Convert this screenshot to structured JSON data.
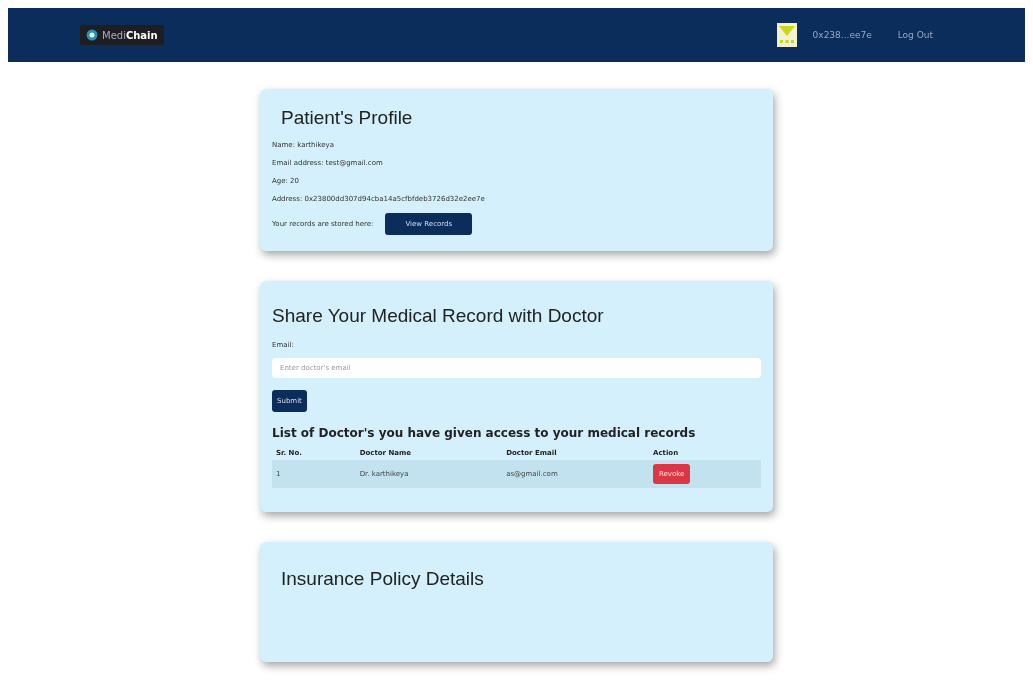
{
  "navbar": {
    "brand_light": "Medi",
    "brand_bold": "Chain",
    "account": "0x238...ee7e",
    "logout": "Log Out"
  },
  "profile": {
    "title": "Patient's Profile",
    "lines": [
      "Name: karthikeya",
      "Email address: test@gmail.com",
      "Age: 20",
      "Address: 0x23800dd307d94cba14a5cfbfdeb3726d32e2ee7e"
    ],
    "records_label": "Your records are stored here:",
    "records_button": "View Records"
  },
  "share": {
    "title": "Share Your Medical Record with Doctor",
    "email_label": "Email:",
    "placeholder": "Enter doctor's email",
    "submit": "Submit",
    "list_title": "List of Doctor's you have given access to your medical records",
    "columns": [
      "Sr. No.",
      "Doctor Name",
      "Doctor Email",
      "Action"
    ],
    "rows": [
      {
        "cells": [
          "1",
          "Dr. karthikeya",
          "as@gmail.com"
        ],
        "action": "Revoke"
      }
    ]
  },
  "insurance": {
    "title": "Insurance Policy Details"
  }
}
